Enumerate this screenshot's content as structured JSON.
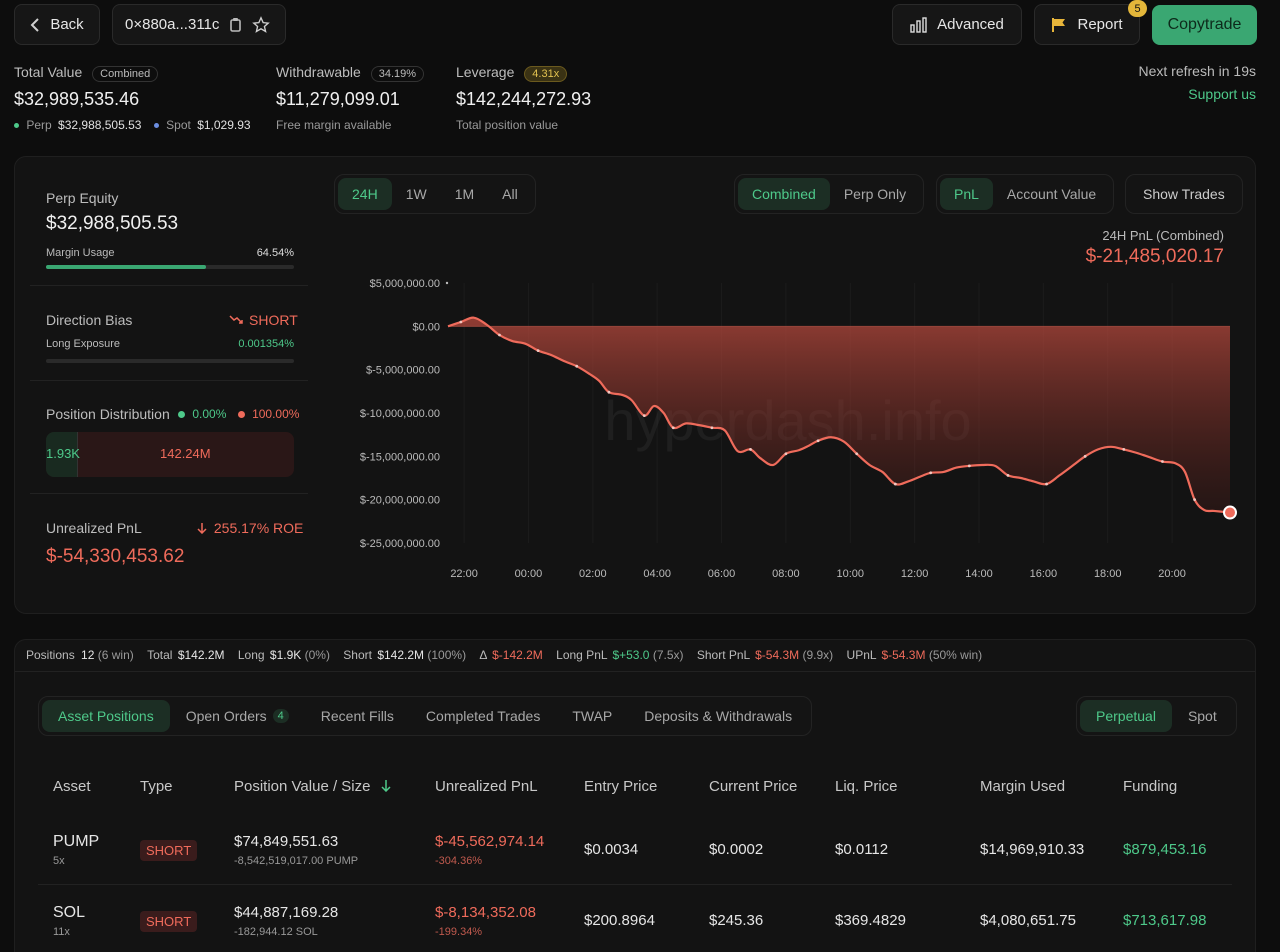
{
  "header": {
    "back_label": "Back",
    "address": "0×880a...311c",
    "advanced_label": "Advanced",
    "report_label": "Report",
    "report_badge": "5",
    "copytrade_label": "Copytrade"
  },
  "summary": {
    "total_value_label": "Total Value",
    "total_value_pill": "Combined",
    "total_value": "$32,989,535.46",
    "perp_label": "Perp",
    "perp_value": "$32,988,505.53",
    "spot_label": "Spot",
    "spot_value": "$1,029.93",
    "withdrawable_label": "Withdrawable",
    "withdrawable_pill": "34.19%",
    "withdrawable_value": "$11,279,099.01",
    "withdrawable_sub": "Free margin available",
    "leverage_label": "Leverage",
    "leverage_pill": "4.31x",
    "leverage_value": "$142,244,272.93",
    "leverage_sub": "Total position value",
    "refresh_text": "Next refresh in 19s",
    "support_label": "Support us"
  },
  "left_panel": {
    "perp_equity_label": "Perp Equity",
    "perp_equity_value": "$32,988,505.53",
    "margin_usage_label": "Margin Usage",
    "margin_usage_value": "64.54%",
    "margin_usage_fraction": 0.6454,
    "direction_bias_label": "Direction Bias",
    "direction_bias_value": "SHORT",
    "long_exposure_label": "Long Exposure",
    "long_exposure_value": "0.001354%",
    "position_dist_label": "Position Distribution",
    "dist_long_pct": "0.00%",
    "dist_short_pct": "100.00%",
    "dist_long_value": "1.93K",
    "dist_short_value": "142.24M",
    "unrealized_label": "Unrealized PnL",
    "roe_value": "255.17% ROE",
    "unrealized_value": "$-54,330,453.62"
  },
  "chart_controls": {
    "ranges": [
      "24H",
      "1W",
      "1M",
      "All"
    ],
    "modes": [
      "Combined",
      "Perp Only"
    ],
    "metrics": [
      "PnL",
      "Account Value"
    ],
    "show_trades_label": "Show Trades",
    "pnl_title": "24H PnL (Combined)",
    "pnl_value": "$-21,485,020.17",
    "watermark": "hyperdash.info"
  },
  "chart_data": {
    "type": "area",
    "title": "24H PnL (Combined)",
    "y_ticks": [
      "$5,000,000.00",
      "$0.00",
      "$-5,000,000.00",
      "$-10,000,000.00",
      "$-15,000,000.00",
      "$-20,000,000.00",
      "$-25,000,000.00"
    ],
    "x_ticks": [
      "22:00",
      "00:00",
      "02:00",
      "04:00",
      "06:00",
      "08:00",
      "10:00",
      "12:00",
      "14:00",
      "16:00",
      "18:00",
      "20:00"
    ],
    "ylim": [
      -25000000,
      5000000
    ],
    "xlim_hours": [
      21.5,
      45.8
    ],
    "grid": true,
    "series": [
      {
        "x": [
          21.5,
          21.9,
          22.3,
          22.7,
          23.1,
          23.5,
          23.9,
          24.3,
          24.7,
          25.1,
          25.5,
          25.9,
          26.2,
          26.5,
          26.9,
          27.2,
          27.6,
          27.9,
          28.2,
          28.5,
          28.9,
          29.3,
          29.7,
          30.1,
          30.5,
          30.9,
          31.2,
          31.6,
          32.0,
          32.4,
          32.7,
          33.0,
          33.4,
          33.8,
          34.2,
          34.6,
          35.0,
          35.4,
          35.8,
          36.2,
          36.5,
          36.9,
          37.3,
          37.7,
          38.1,
          38.5,
          38.9,
          39.3,
          39.7,
          40.1,
          40.5,
          40.9,
          41.3,
          41.7,
          42.1,
          42.5,
          42.9,
          43.3,
          43.7,
          44.1,
          44.4,
          44.7,
          45.0,
          45.3,
          45.8
        ],
        "y": [
          0,
          500000,
          1000000,
          200000,
          -1000000,
          -1700000,
          -2000000,
          -2800000,
          -3300000,
          -4000000,
          -4600000,
          -5500000,
          -6300000,
          -7600000,
          -7900000,
          -8500000,
          -10300000,
          -9200000,
          -10000000,
          -11700000,
          -11200000,
          -11400000,
          -11700000,
          -12000000,
          -14400000,
          -14200000,
          -15200000,
          -16000000,
          -14700000,
          -14300000,
          -13800000,
          -13200000,
          -12800000,
          -13300000,
          -14700000,
          -16000000,
          -16800000,
          -18200000,
          -17900000,
          -17300000,
          -16900000,
          -16800000,
          -16300000,
          -16100000,
          -16000000,
          -16100000,
          -17200000,
          -17500000,
          -17900000,
          -18200000,
          -17200000,
          -16100000,
          -15000000,
          -14200000,
          -13900000,
          -14200000,
          -14600000,
          -15100000,
          -15600000,
          -15800000,
          -16800000,
          -20000000,
          -21200000,
          -21300000,
          -21485020
        ]
      }
    ]
  },
  "stats_bar": {
    "positions_label": "Positions",
    "positions_count": "12",
    "positions_win": "(6 win)",
    "total_label": "Total",
    "total_value": "$142.2M",
    "long_label": "Long",
    "long_value": "$1.9K",
    "long_pct": "(0%)",
    "short_label": "Short",
    "short_value": "$142.2M",
    "short_pct": "(100%)",
    "delta_label": "Δ",
    "delta_value": "$-142.2M",
    "long_pnl_label": "Long PnL",
    "long_pnl_value": "$+53.0",
    "long_pnl_lev": "(7.5x)",
    "short_pnl_label": "Short PnL",
    "short_pnl_value": "$-54.3M",
    "short_pnl_lev": "(9.9x)",
    "upnl_label": "UPnL",
    "upnl_value": "$-54.3M",
    "upnl_win": "(50% win)"
  },
  "tabs": {
    "items": [
      "Asset Positions",
      "Open Orders",
      "Recent Fills",
      "Completed Trades",
      "TWAP",
      "Deposits & Withdrawals"
    ],
    "open_orders_badge": "4",
    "market_items": [
      "Perpetual",
      "Spot"
    ]
  },
  "table": {
    "headers": [
      "Asset",
      "Type",
      "Position Value / Size",
      "Unrealized PnL",
      "Entry Price",
      "Current Price",
      "Liq. Price",
      "Margin Used",
      "Funding"
    ],
    "rows": [
      {
        "asset": "PUMP",
        "lev": "5x",
        "type": "SHORT",
        "value": "$74,849,551.63",
        "size": "-8,542,519,017.00 PUMP",
        "upnl": "$-45,562,974.14",
        "upnl_pct": "-304.36%",
        "entry": "$0.0034",
        "current": "$0.0002",
        "liq": "$0.0112",
        "margin": "$14,969,910.33",
        "funding": "$879,453.16"
      },
      {
        "asset": "SOL",
        "lev": "11x",
        "type": "SHORT",
        "value": "$44,887,169.28",
        "size": "-182,944.12 SOL",
        "upnl": "$-8,134,352.08",
        "upnl_pct": "-199.34%",
        "entry": "$200.8964",
        "current": "$245.36",
        "liq": "$369.4829",
        "margin": "$4,080,651.75",
        "funding": "$713,617.98"
      }
    ]
  },
  "colors": {
    "accent_green": "#4ec98a",
    "loss_red": "#ef6b5b",
    "copytrade_bg": "#3aa772",
    "leverage_pill": "#d9b444"
  }
}
